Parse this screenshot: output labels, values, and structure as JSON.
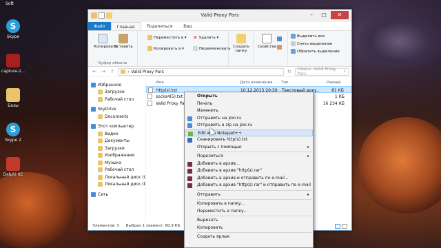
{
  "desktop": {
    "top_label": "Soft",
    "icons": [
      {
        "label": "Skype"
      },
      {
        "label": "capture-1..."
      },
      {
        "label": "Базы"
      },
      {
        "label": "Skype 2"
      },
      {
        "label": "Delphi XE"
      }
    ]
  },
  "window": {
    "title": "Valid Proxy Pars",
    "tabs": [
      "Файл",
      "Главная",
      "Поделиться",
      "Вид"
    ],
    "ribbon": {
      "copy": "Копировать",
      "paste": "Вставить",
      "clipboard_group": "Буфер обмена",
      "move_to": "Переместить в ▾",
      "copy_to": "Копировать в ▾",
      "delete": "Удалить ▾",
      "rename": "Переименовать",
      "new_folder": "Создать папку",
      "properties": "Свойства",
      "select_all": "Выделить все",
      "deselect": "Снять выделение",
      "invert": "Обратить выделение"
    },
    "address": {
      "path": "Valid Proxy Pars",
      "search_placeholder": "Поиск: Valid Proxy Pars"
    },
    "nav": [
      {
        "label": "Избранное",
        "indent": 0
      },
      {
        "label": "Загрузки",
        "indent": 1
      },
      {
        "label": "Рабочий стол",
        "indent": 1
      },
      {
        "label": "SkyDrive",
        "indent": 0
      },
      {
        "label": "Documents",
        "indent": 1
      },
      {
        "label": "Этот компьютер",
        "indent": 0
      },
      {
        "label": "Видео",
        "indent": 1
      },
      {
        "label": "Документы",
        "indent": 1
      },
      {
        "label": "Загрузки",
        "indent": 1
      },
      {
        "label": "Изображения",
        "indent": 1
      },
      {
        "label": "Музыка",
        "indent": 1
      },
      {
        "label": "Рабочий стол",
        "indent": 1
      },
      {
        "label": "Локальный диск (C",
        "indent": 1
      },
      {
        "label": "Локальный диск (D",
        "indent": 1
      },
      {
        "label": "Сеть",
        "indent": 0
      }
    ],
    "columns": {
      "name": "Имя",
      "date": "Дата изменения",
      "type": "Тип",
      "size": "Размер"
    },
    "files": [
      {
        "name": "http(s).txt",
        "date": "10.12.2013 20:30",
        "type": "Текстовый доку...",
        "size": "81 КБ",
        "selected": true
      },
      {
        "name": "socks4(5).txt",
        "date": "",
        "type": "",
        "size": "1 КБ",
        "selected": false
      },
      {
        "name": "Valid Proxy Pars",
        "date": "",
        "type": "",
        "size": "16 234 КБ",
        "selected": false
      }
    ],
    "status": {
      "count": "Элементов: 3",
      "selected": "Выбран 1 элемент: 80,9 КБ"
    }
  },
  "context_menu": [
    {
      "label": "Открыть",
      "bold": true
    },
    {
      "label": "Печать"
    },
    {
      "label": "Изменить"
    },
    {
      "label": "Отправить на joxi.ru",
      "icon": "#4a8fd6"
    },
    {
      "label": "Отправить в zip на joxi.ru",
      "icon": "#4a8fd6"
    },
    {
      "label": "Edit with Notepad++",
      "icon": "#6fb83e",
      "highlight": true
    },
    {
      "label": "Сканировать http(s).txt",
      "icon": "#3a6ab8"
    },
    {
      "label": "Открыть с помощью",
      "arrow": true
    },
    {
      "sep": true
    },
    {
      "label": "Поделиться",
      "arrow": true
    },
    {
      "label": "Добавить в архив...",
      "icon": "#7a2a4a"
    },
    {
      "label": "Добавить в архив \"http(s).rar\"",
      "icon": "#7a2a4a"
    },
    {
      "label": "Добавить в архив и отправить по e-mail...",
      "icon": "#7a2a4a"
    },
    {
      "label": "Добавить в архив \"http(s).rar\" и отправить по e-mail",
      "icon": "#7a2a4a"
    },
    {
      "sep": true
    },
    {
      "label": "Отправить",
      "arrow": true
    },
    {
      "sep": true
    },
    {
      "label": "Копировать в папку..."
    },
    {
      "label": "Переместить в папку..."
    },
    {
      "sep": true
    },
    {
      "label": "Вырезать"
    },
    {
      "label": "Копировать"
    },
    {
      "sep": true
    },
    {
      "label": "Создать ярлык"
    }
  ]
}
